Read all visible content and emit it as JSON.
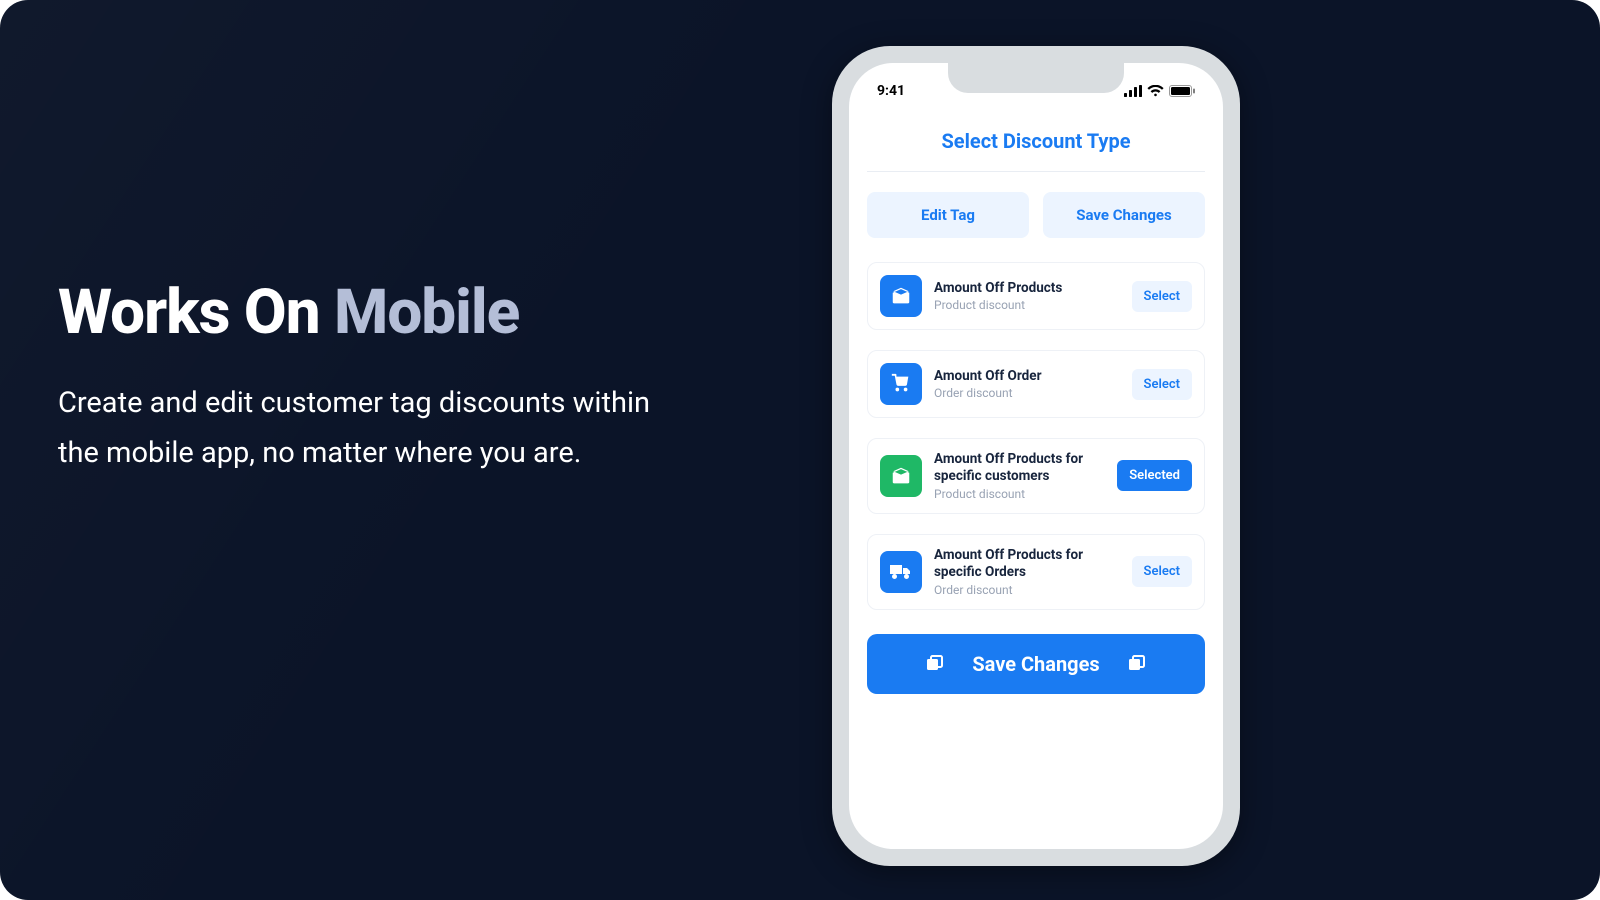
{
  "hero": {
    "title_part1": "Works On ",
    "title_accent": "Mobile",
    "body": "Create and edit customer tag discounts within the mobile app, no matter where you are."
  },
  "phone": {
    "status": {
      "time": "9:41"
    },
    "app": {
      "title": "Select Discount Type",
      "tabs": [
        {
          "label": "Edit Tag"
        },
        {
          "label": "Save Changes"
        }
      ],
      "options": [
        {
          "title": "Amount Off Products",
          "sub": "Product discount",
          "btn": "Select",
          "icon": "box",
          "color": "blue",
          "selected": false
        },
        {
          "title": "Amount Off Order",
          "sub": "Order discount",
          "btn": "Select",
          "icon": "cart",
          "color": "blue",
          "selected": false
        },
        {
          "title": "Amount Off Products for specific customers",
          "sub": "Product discount",
          "btn": "Selected",
          "icon": "box",
          "color": "green",
          "selected": true
        },
        {
          "title": "Amount Off Products for specific Orders",
          "sub": "Order discount",
          "btn": "Select",
          "icon": "truck",
          "color": "blue",
          "selected": false
        }
      ],
      "save_label": "Save Changes"
    }
  }
}
